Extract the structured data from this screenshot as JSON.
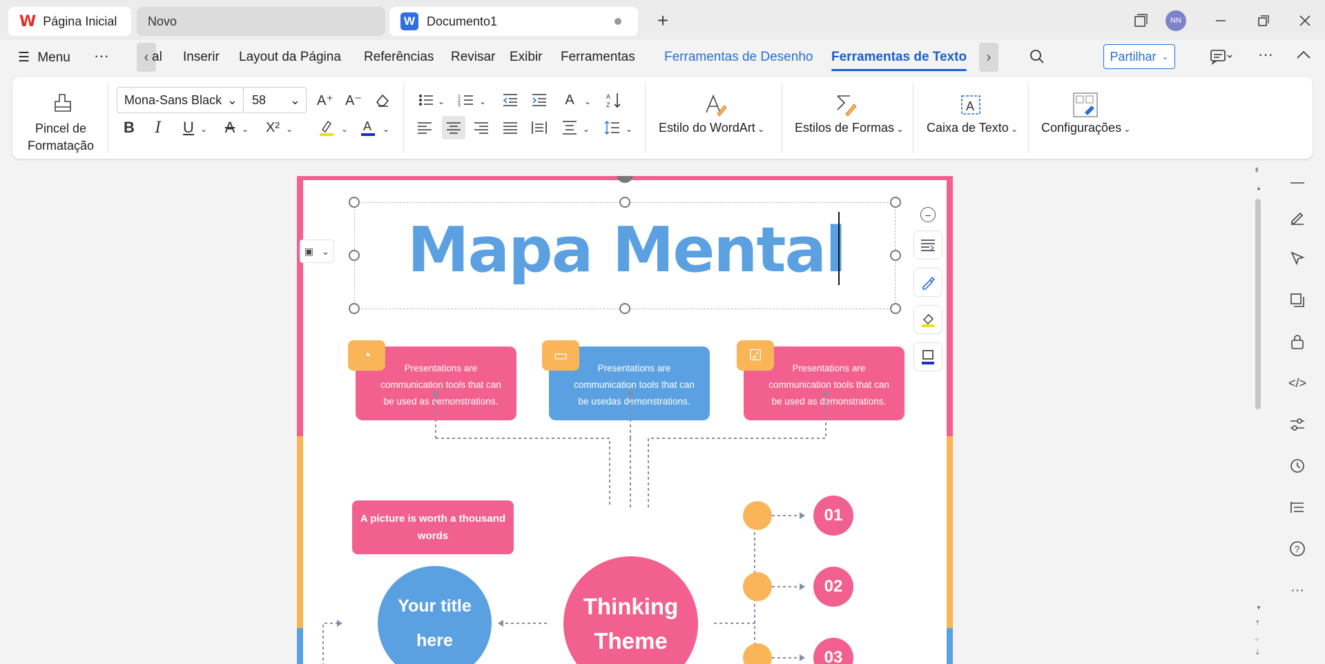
{
  "tabs": {
    "home": "Página Inicial",
    "novo": "Novo",
    "doc": "Documento1",
    "plus": "+"
  },
  "user": {
    "initials": "NN"
  },
  "menu": {
    "menu_label": "Menu",
    "more": "···",
    "partial": "al",
    "items": [
      "Inserir",
      "Layout da Página",
      "Referências",
      "Revisar",
      "Exibir",
      "Ferramentas"
    ],
    "drawing_tools": "Ferramentas de Desenho",
    "text_tools": "Ferramentas de Texto",
    "share": "Partilhar"
  },
  "ribbon": {
    "format_painter": [
      "Pincel de",
      "Formatação"
    ],
    "font_name": "Mona-Sans Black",
    "font_size": "58",
    "wordart": "Estilo do WordArt",
    "shape_styles": "Estilos de Formas",
    "text_box": "Caixa de Texto",
    "settings": "Configurações"
  },
  "document": {
    "title": "Mapa Mental",
    "cards": [
      {
        "text": "Presentations are communication tools that can be used as demonstrations.",
        "color": "#f2608f"
      },
      {
        "text": "Presentations are communication tools that can be usedas demonstrations.",
        "color": "#5ba1e1"
      },
      {
        "text": "Presentations are communication tools that can be used as demonstrations.",
        "color": "#f2608f"
      }
    ],
    "pill_text": "A picture is worth a thousand words",
    "your_title": "Your title here",
    "theme": "Thinking Theme",
    "numbers": [
      "01",
      "02",
      "03"
    ]
  },
  "colors": {
    "pink": "#f2608f",
    "blue": "#5ba1e1",
    "orange": "#f9b558",
    "accent": "#1a5fd0"
  }
}
